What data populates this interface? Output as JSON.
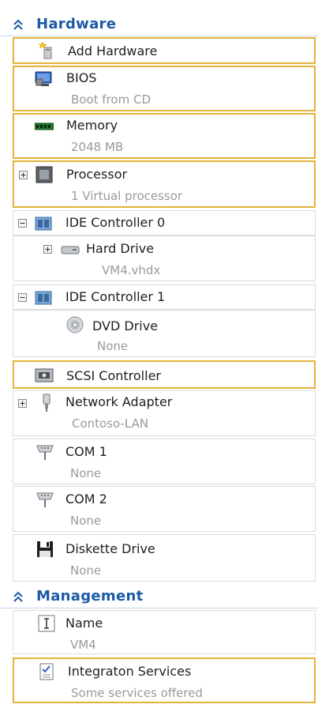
{
  "hardware_section": {
    "title": "Hardware"
  },
  "management_section": {
    "title": "Management"
  },
  "items": {
    "add_hardware": {
      "label": "Add Hardware"
    },
    "bios": {
      "label": "BIOS",
      "value": "Boot from CD"
    },
    "memory": {
      "label": "Memory",
      "value": "2048 MB"
    },
    "processor": {
      "label": "Processor",
      "value": "1 Virtual processor"
    },
    "ide0": {
      "label": "IDE Controller 0"
    },
    "hard_drive": {
      "label": "Hard Drive",
      "value": "VM4.vhdx"
    },
    "ide1": {
      "label": "IDE Controller 1"
    },
    "dvd_drive": {
      "label": "DVD Drive",
      "value": "None"
    },
    "scsi": {
      "label": "SCSI Controller"
    },
    "network": {
      "label": "Network Adapter",
      "value": "Contoso-LAN"
    },
    "com1": {
      "label": "COM 1",
      "value": "None"
    },
    "com2": {
      "label": "COM 2",
      "value": "None"
    },
    "diskette": {
      "label": "Diskette Drive",
      "value": "None"
    },
    "name": {
      "label": "Name",
      "value": "VM4"
    },
    "integration": {
      "label": "Integraton Services",
      "value": "Some services offered"
    }
  },
  "colors": {
    "section_title": "#1c59a6",
    "highlight_border": "#e3b33a",
    "subtext": "#9a9a9a"
  },
  "icons": {
    "collapse": "double-chevron-up-icon",
    "add_hardware": "add-hardware-icon",
    "bios": "bios-icon",
    "memory": "memory-icon",
    "processor": "processor-icon",
    "ide": "ide-controller-icon",
    "hard_drive": "hard-drive-icon",
    "dvd": "dvd-drive-icon",
    "scsi": "scsi-controller-icon",
    "network": "network-adapter-icon",
    "com": "com-port-icon",
    "diskette": "diskette-icon",
    "name": "name-icon",
    "integration": "integration-services-icon"
  }
}
